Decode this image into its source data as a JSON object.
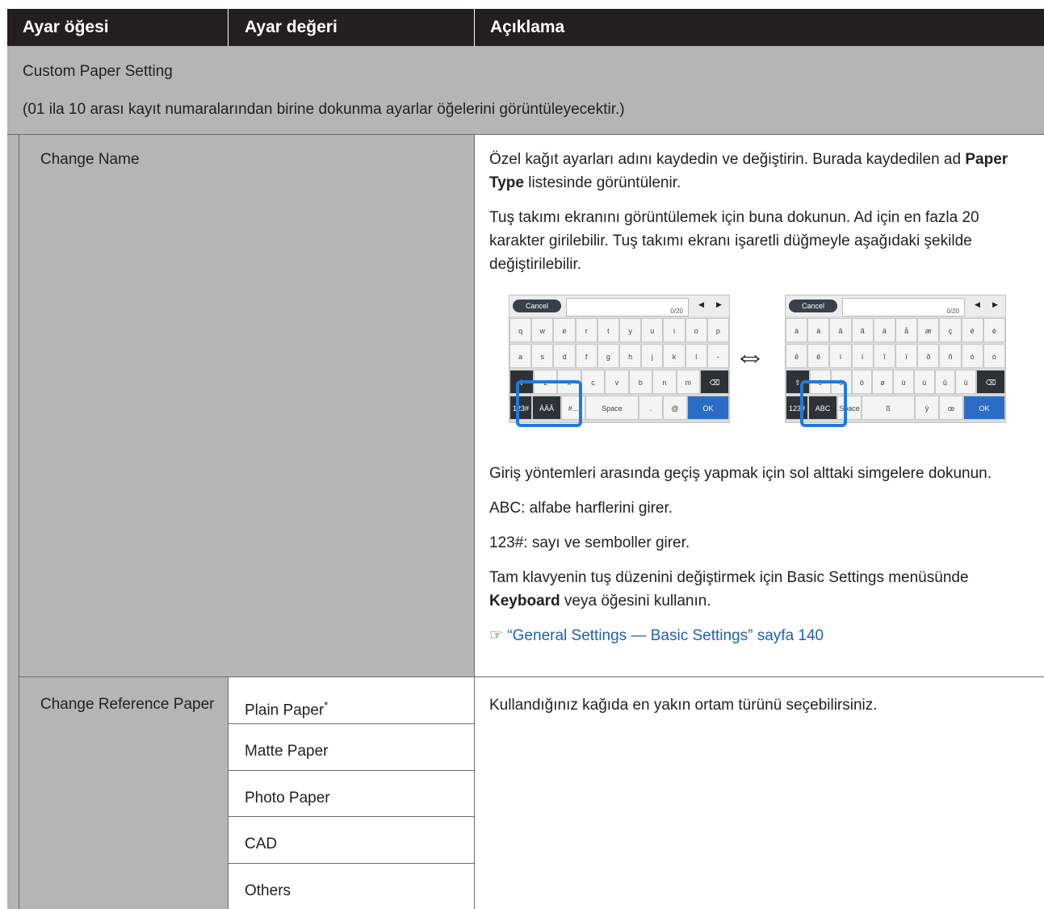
{
  "header": {
    "col1": "Ayar öğesi",
    "col2": "Ayar değeri",
    "col3": "Açıklama"
  },
  "section": {
    "title": "Custom Paper Setting",
    "note": "(01 ila 10 arası kayıt numaralarından birine dokunma ayarlar öğelerini görüntüleyecektir.)"
  },
  "change_name": {
    "item": "Change Name",
    "desc": {
      "p1_a": "Özel kağıt ayarları adını kaydedin ve değiştirin. Burada kaydedilen ad ",
      "p1_b": "Paper Type",
      "p1_c": " listesinde görüntülenir.",
      "p2": "Tuş takımı ekranını görüntülemek için buna dokunun. Ad için en fazla 20 karakter girilebilir. Tuş takımı ekranı işaretli düğmeyle aşağıdaki şekilde değiştirilebilir.",
      "p3": "Giriş yöntemleri arasında geçiş yapmak için sol alttaki simgelere dokunun.",
      "p4": "ABC: alfabe harflerini girer.",
      "p5": "123#: sayı ve semboller girer.",
      "p6_a": "Tam klavyenin tuş düzenini değiştirmek için Basic Settings menüsünde ",
      "p6_b": "Keyboard",
      "p6_c": " veya öğesini kullanın.",
      "link_icon": "☞",
      "link": "“General Settings — Basic Settings” sayfa 140"
    },
    "keyboard_left": {
      "cancel": "Cancel",
      "counter": "0/20",
      "row1": [
        "q",
        "w",
        "e",
        "r",
        "t",
        "y",
        "u",
        "i",
        "o",
        "p"
      ],
      "row2": [
        "a",
        "s",
        "d",
        "f",
        "g",
        "h",
        "j",
        "k",
        "l",
        "-"
      ],
      "row3": [
        "z",
        "x",
        "c",
        "v",
        "b",
        "n",
        "m"
      ],
      "row4": [
        "123#",
        "ÀÄÂ",
        "#...",
        "Space",
        ".",
        "@",
        "OK"
      ]
    },
    "swap_arrow": "⇔",
    "keyboard_right": {
      "cancel": "Cancel",
      "counter": "0/20",
      "row1": [
        "à",
        "á",
        "â",
        "ã",
        "ä",
        "å",
        "æ",
        "ç",
        "è",
        "é"
      ],
      "row2": [
        "ê",
        "ë",
        "ì",
        "í",
        "î",
        "ï",
        "ð",
        "ñ",
        "ò",
        "ó"
      ],
      "row3": [
        "ô",
        "õ",
        "ö",
        "ø",
        "ù",
        "ú",
        "û",
        "ü"
      ],
      "row4": [
        "123#",
        "ABC",
        "Space",
        "ß",
        "ÿ",
        "œ",
        "OK"
      ]
    }
  },
  "change_reference": {
    "item": "Change Reference Paper",
    "values": [
      {
        "label": "Plain Paper",
        "mark": "*"
      },
      {
        "label": "Matte Paper",
        "mark": ""
      },
      {
        "label": "Photo Paper",
        "mark": ""
      },
      {
        "label": "CAD",
        "mark": ""
      },
      {
        "label": "Others",
        "mark": ""
      }
    ],
    "desc": "Kullandığınız kağıda en yakın ortam türünü seçebilirsiniz."
  }
}
